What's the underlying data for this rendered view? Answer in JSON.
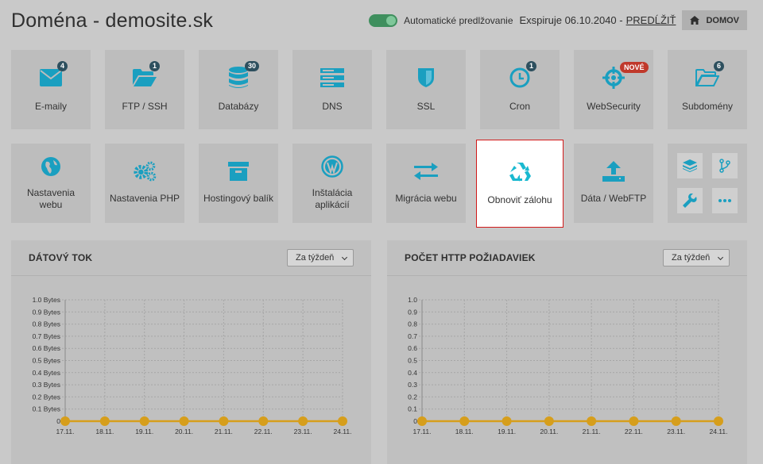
{
  "page": {
    "title": "Doména - demosite.sk"
  },
  "topbar": {
    "auto_renew_label": "Automatické predlžovanie",
    "expires_text": "Exspiruje 06.10.2040 -",
    "renew_label": "PREDĹŽIŤ",
    "home_label": "DOMOV"
  },
  "tiles_row1": [
    {
      "label": "E-maily",
      "icon": "envelope-icon",
      "badge": "4"
    },
    {
      "label": "FTP / SSH",
      "icon": "folder-open-icon",
      "badge": "1"
    },
    {
      "label": "Databázy",
      "icon": "database-icon",
      "badge": "30"
    },
    {
      "label": "DNS",
      "icon": "server-icon",
      "badge": ""
    },
    {
      "label": "SSL",
      "icon": "shield-icon",
      "badge": ""
    },
    {
      "label": "Cron",
      "icon": "clock-icon",
      "badge": "1"
    },
    {
      "label": "WebSecurity",
      "icon": "crosshair-icon",
      "badge": "NOVÉ"
    },
    {
      "label": "Subdomény",
      "icon": "folder-icon",
      "badge": "6"
    }
  ],
  "tiles_row2": [
    {
      "label": "Nastavenia webu",
      "icon": "globe-icon"
    },
    {
      "label": "Nastavenia PHP",
      "icon": "gears-icon"
    },
    {
      "label": "Hostingový balík",
      "icon": "archive-icon"
    },
    {
      "label": "Inštalácia aplikácií",
      "icon": "wordpress-icon"
    },
    {
      "label": "Migrácia webu",
      "icon": "exchange-icon"
    },
    {
      "label": "Obnoviť zálohu",
      "icon": "recycle-icon"
    },
    {
      "label": "Dáta / WebFTP",
      "icon": "upload-icon"
    }
  ],
  "mini_tools": [
    "layers-icon",
    "git-branch-icon",
    "wrench-icon",
    "more-icon"
  ],
  "colors": {
    "accent": "#1a9fc0",
    "highlight_border": "#d11a1a",
    "series": "#d69e1c"
  },
  "panels": [
    {
      "title": "DÁTOVÝ TOK",
      "period": "Za týždeň"
    },
    {
      "title": "POČET HTTP POŽIADAVIEK",
      "period": "Za týždeň"
    }
  ],
  "chart_data": [
    {
      "type": "line",
      "title": "DÁTOVÝ TOK",
      "categories": [
        "17.11.",
        "18.11.",
        "19.11.",
        "20.11.",
        "21.11.",
        "22.11.",
        "23.11.",
        "24.11."
      ],
      "values": [
        0,
        0,
        0,
        0,
        0,
        0,
        0,
        0
      ],
      "yticks": [
        "0",
        "0.1 Bytes",
        "0.2 Bytes",
        "0.3 Bytes",
        "0.4 Bytes",
        "0.5 Bytes",
        "0.6 Bytes",
        "0.7 Bytes",
        "0.8 Bytes",
        "0.9 Bytes",
        "1.0 Bytes"
      ],
      "ylim": [
        0,
        1
      ],
      "grid": true
    },
    {
      "type": "line",
      "title": "POČET HTTP POŽIADAVIEK",
      "categories": [
        "17.11.",
        "18.11.",
        "19.11.",
        "20.11.",
        "21.11.",
        "22.11.",
        "23.11.",
        "24.11."
      ],
      "values": [
        0,
        0,
        0,
        0,
        0,
        0,
        0,
        0
      ],
      "yticks": [
        "0",
        "0.1",
        "0.2",
        "0.3",
        "0.4",
        "0.5",
        "0.6",
        "0.7",
        "0.8",
        "0.9",
        "1.0"
      ],
      "ylim": [
        0,
        1
      ],
      "grid": true
    }
  ]
}
